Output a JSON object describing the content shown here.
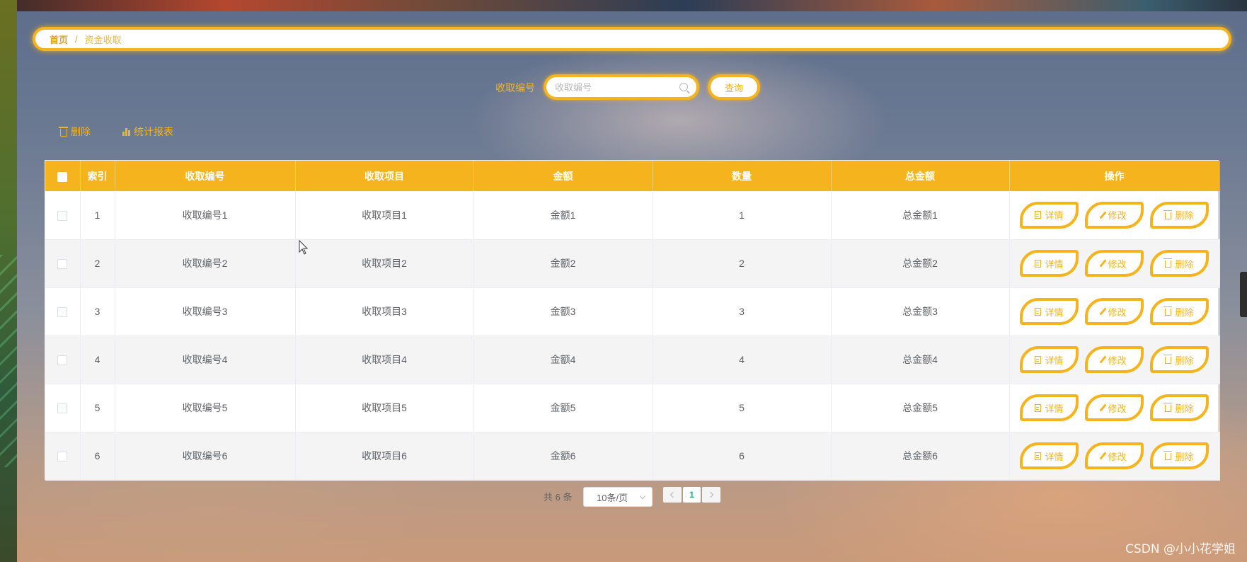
{
  "breadcrumb": {
    "home": "首页",
    "separator": "/",
    "current": "资金收取"
  },
  "search": {
    "label": "收取编号",
    "placeholder": "收取编号",
    "value": "",
    "button": "查询"
  },
  "toolbar": {
    "delete": "删除",
    "report": "统计报表"
  },
  "table": {
    "columns": [
      "索引",
      "收取编号",
      "收取项目",
      "金额",
      "数量",
      "总金额",
      "操作"
    ],
    "rows": [
      {
        "index": "1",
        "code": "收取编号1",
        "item": "收取项目1",
        "amount": "金额1",
        "qty": "1",
        "total": "总金额1"
      },
      {
        "index": "2",
        "code": "收取编号2",
        "item": "收取项目2",
        "amount": "金额2",
        "qty": "2",
        "total": "总金额2"
      },
      {
        "index": "3",
        "code": "收取编号3",
        "item": "收取项目3",
        "amount": "金额3",
        "qty": "3",
        "total": "总金额3"
      },
      {
        "index": "4",
        "code": "收取编号4",
        "item": "收取项目4",
        "amount": "金额4",
        "qty": "4",
        "total": "总金额4"
      },
      {
        "index": "5",
        "code": "收取编号5",
        "item": "收取项目5",
        "amount": "金额5",
        "qty": "5",
        "total": "总金额5"
      },
      {
        "index": "6",
        "code": "收取编号6",
        "item": "收取项目6",
        "amount": "金额6",
        "qty": "6",
        "total": "总金额6"
      }
    ],
    "actions": {
      "detail": "详情",
      "edit": "修改",
      "delete": "删除"
    }
  },
  "pagination": {
    "total": "共 6 条",
    "page_size": "10条/页",
    "current_page": "1"
  },
  "watermark": "CSDN @小小花学姐",
  "colors": {
    "accent": "#f5b31d",
    "text": "#606266",
    "active_page": "#12b886"
  },
  "icons": {
    "toolbar_delete": "trash-icon",
    "toolbar_report": "bar-chart-icon",
    "search": "search-icon",
    "detail": "document-icon",
    "edit": "pencil-icon",
    "delete": "trash-icon",
    "pager_prev": "chevron-left-icon",
    "pager_next": "chevron-right-icon",
    "page_size": "chevron-down-icon"
  }
}
